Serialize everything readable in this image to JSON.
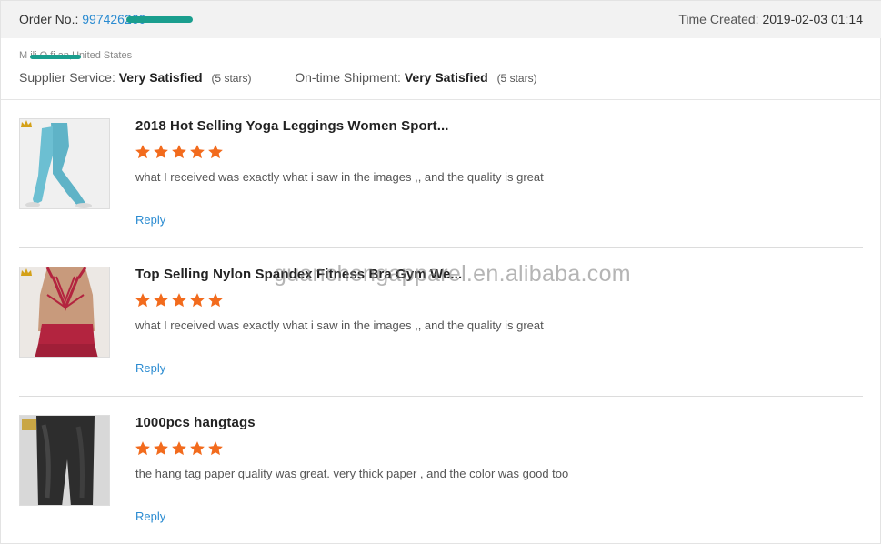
{
  "order": {
    "label": "Order No.: ",
    "number": "997426260",
    "time_label": "Time Created: ",
    "time_value": "2019-02-03 01:14"
  },
  "buyer": {
    "location": "M  ili  O  fi  an,United States"
  },
  "ratings": {
    "supplier_label": "Supplier Service:",
    "supplier_value": "Very Satisfied",
    "supplier_stars": "(5 stars)",
    "shipment_label": "On-time Shipment:",
    "shipment_value": "Very Satisfied",
    "shipment_stars": "(5 stars)"
  },
  "reviews": [
    {
      "title": "2018 Hot Selling Yoga Leggings Women Sport...",
      "rating": 5,
      "comment": "what I received was exactly what i saw in the images ,,  and the quality is great",
      "reply": "Reply"
    },
    {
      "title": "Top Selling Nylon Spandex Fitness Bra Gym We...",
      "rating": 5,
      "comment": "what I received was exactly what i saw in the images ,,  and the quality is great",
      "reply": "Reply"
    },
    {
      "title": "1000pcs hangtags",
      "rating": 5,
      "comment": "the hang tag paper quality was great.  very thick paper , and the color was good too",
      "reply": "Reply"
    }
  ],
  "watermark": "guanchengapparel.en.alibaba.com",
  "colors": {
    "link": "#2a8bd1",
    "star": "#f26b1d",
    "header_bg": "#f2f2f2"
  },
  "icons": {
    "star": "star-icon",
    "crown": "crown-icon"
  }
}
